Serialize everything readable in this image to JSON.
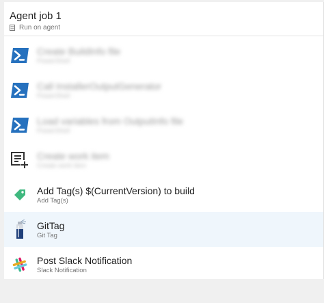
{
  "job": {
    "title": "Agent job 1",
    "subtitle": "Run on agent"
  },
  "tasks": [
    {
      "name": "Create BuildInfo file",
      "type": "PowerShell",
      "icon": "powershell-icon",
      "blurred": true
    },
    {
      "name": "Call InstallerOutputGenerator",
      "type": "PowerShell",
      "icon": "powershell-icon",
      "blurred": true
    },
    {
      "name": "Load variables from OutputInfo file",
      "type": "PowerShell",
      "icon": "powershell-icon",
      "blurred": true
    },
    {
      "name": "Create work item",
      "type": "Create work item",
      "icon": "create-work-item-icon",
      "blurred": true
    },
    {
      "name": "Add Tag(s) $(CurrentVersion) to build",
      "type": "Add Tag(s)",
      "icon": "tag-icon",
      "blurred": false
    },
    {
      "name": "GitTag",
      "type": "Git Tag",
      "icon": "git-tag-icon",
      "blurred": false,
      "selected": true
    },
    {
      "name": "Post Slack Notification",
      "type": "Slack Notification",
      "icon": "slack-icon",
      "blurred": false
    }
  ],
  "colors": {
    "powershell": "#2671be",
    "tag": "#3fb87f",
    "selected_bg": "#eff6fc"
  }
}
